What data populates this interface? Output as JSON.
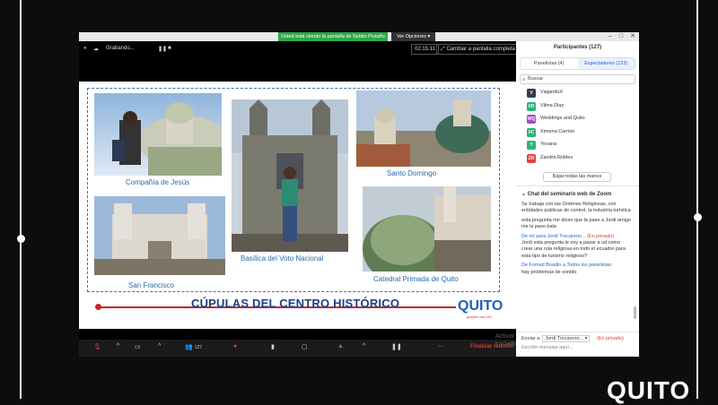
{
  "window": {
    "share_banner": "Usted está viendo la pantalla de Sebito Pozaño",
    "view_options": "Ver Opciones ▾",
    "recording": "Grabando...",
    "timer": "02:15:11",
    "fullscreen": "Cambiar a pantalla completa",
    "end_meeting": "Finalizar reunión",
    "participants_count": "127",
    "watermark_line1": "Activar Windows",
    "watermark_line2": "Ir a Configuración para activar Windows."
  },
  "slide": {
    "captions": {
      "compania": "Compañía  de Jesús",
      "basilica": "Basílica del Voto Nacional",
      "santo_domingo": "Santo Domingo",
      "san_francisco": "San Francisco",
      "catedral": "Catedral Primada de Quito"
    },
    "title": "CÚPULAS DEL CENTRO HISTÓRICO",
    "logo_text": "QUITO",
    "logo_sub": "grande otra vez"
  },
  "panel": {
    "header": "Participantes (127)",
    "tab_panelists": "Panelistas (4)",
    "tab_attendees": "Espectadores (123)",
    "search_placeholder": "Buscar",
    "participants": [
      {
        "initials": "V",
        "name": "ViajandoX",
        "color": "#333a48"
      },
      {
        "initials": "VD",
        "name": "Vilma Diaz",
        "color": "#2bb37a"
      },
      {
        "initials": "WQ",
        "name": "Weddings and Quito",
        "color": "#a349c9"
      },
      {
        "initials": "XC",
        "name": "Ximena Carrion",
        "color": "#2bb37a"
      },
      {
        "initials": "Y",
        "name": "Yovana",
        "color": "#2bb37a"
      },
      {
        "initials": "ZR",
        "name": "Zandra Robles",
        "color": "#e0443f"
      }
    ],
    "invite": "Bajar todas las manos",
    "chat_header": "Chat del seminario web de Zoom",
    "chat_msg1": "Se trabaja con las Ordenes Religiosas, con entidades publicas de control, la industria turística",
    "chat_msg2": "esta pregunta me dicen que la pase a Jordi amigo me la paso bala",
    "chat_from2": "De mí para Jordi Trecareno...",
    "chat_from2_priv": "(En privado)",
    "chat_msg3": "Jordi esta pregunta le voy a pasar a ud como crear una ruta religiosa en todo el ecuador para esta tipo de turismo religioso?",
    "chat_from3": "De Fomad Boadin a Todos los panelistas:",
    "chat_msg4": "hay problemas de sonido",
    "send_to_label": "Enviar a:",
    "send_to_value": "Jordi Trecareno...",
    "send_priv": "(En privado)",
    "send_placeholder": "Escribir mensaje aquí..."
  },
  "corner_logo": "QUITO"
}
